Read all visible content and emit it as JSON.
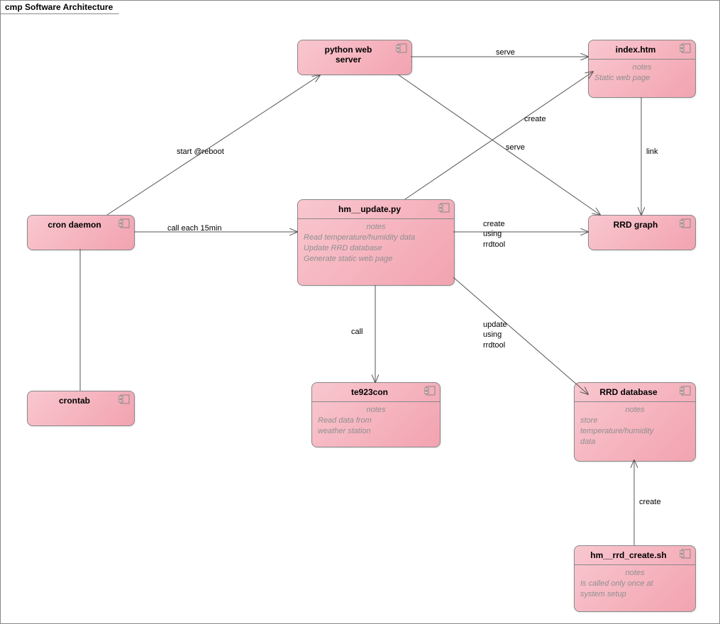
{
  "frame": {
    "title": "cmp Software Architecture"
  },
  "components": {
    "cron_daemon": {
      "title": "cron daemon"
    },
    "crontab": {
      "title": "crontab"
    },
    "python_ws": {
      "title": "python web\nserver"
    },
    "hm_update": {
      "title": "hm__update.py",
      "notes_label": "notes",
      "notes": "Read temperature/humidity data\nUpdate RRD database\nGenerate static web page"
    },
    "te923con": {
      "title": "te923con",
      "notes_label": "notes",
      "notes": "Read data from\nweather station"
    },
    "index_htm": {
      "title": "index.htm",
      "notes_label": "notes",
      "notes": "Static web page"
    },
    "rrd_graph": {
      "title": "RRD graph"
    },
    "rrd_database": {
      "title": "RRD database",
      "notes_label": "notes",
      "notes": "store\ntemperature/humidity\ndata"
    },
    "hm_rrd_create": {
      "title": "hm__rrd_create.sh",
      "notes_label": "notes",
      "notes": "Is called only once at\nsystem setup"
    }
  },
  "edges": {
    "start_reboot": "start @reboot",
    "call_15min": "call each 15min",
    "call": "call",
    "create": "create",
    "link": "link",
    "serve1": "serve",
    "serve2": "serve",
    "create_using": "create\nusing\nrrdtool",
    "update_using": "update\nusing\nrrdtool",
    "create_db": "create"
  }
}
